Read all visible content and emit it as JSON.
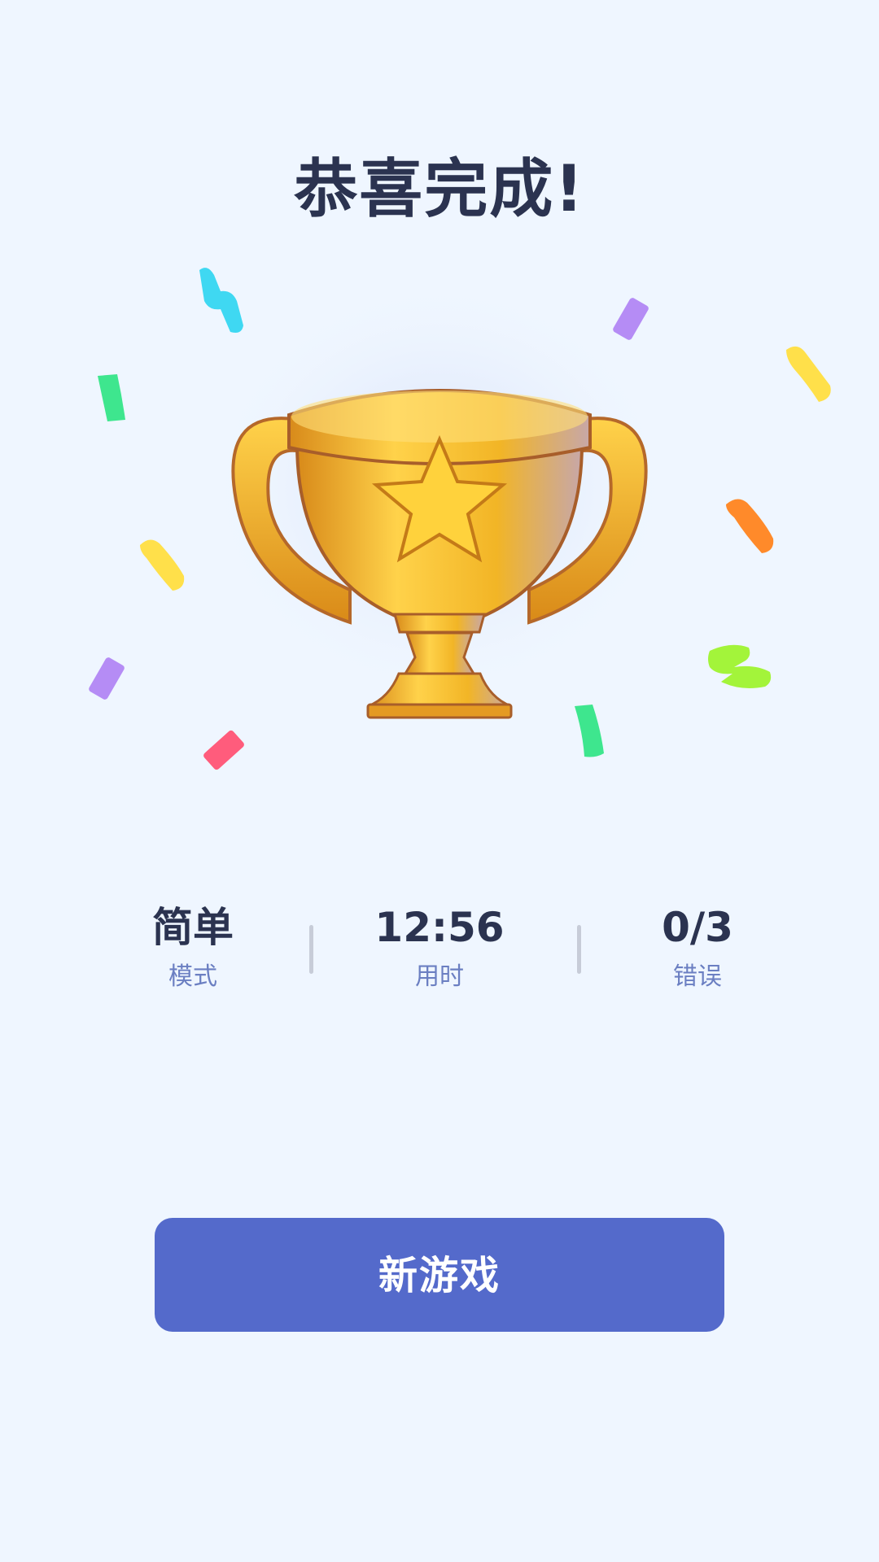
{
  "title": "恭喜完成!",
  "stats": [
    {
      "value": "简单",
      "label": "模式"
    },
    {
      "value": "12:56",
      "label": "用时"
    },
    {
      "value": "0/3",
      "label": "错误"
    }
  ],
  "new_game_button": {
    "label": "新游戏"
  },
  "icons": {
    "trophy": "trophy-with-star-icon",
    "confetti": "confetti-pieces"
  },
  "colors": {
    "background": "#eff6ff",
    "title": "#2b3350",
    "label": "#6b7fc2",
    "button": "#546acb",
    "trophy_gold": "#f2b526"
  }
}
